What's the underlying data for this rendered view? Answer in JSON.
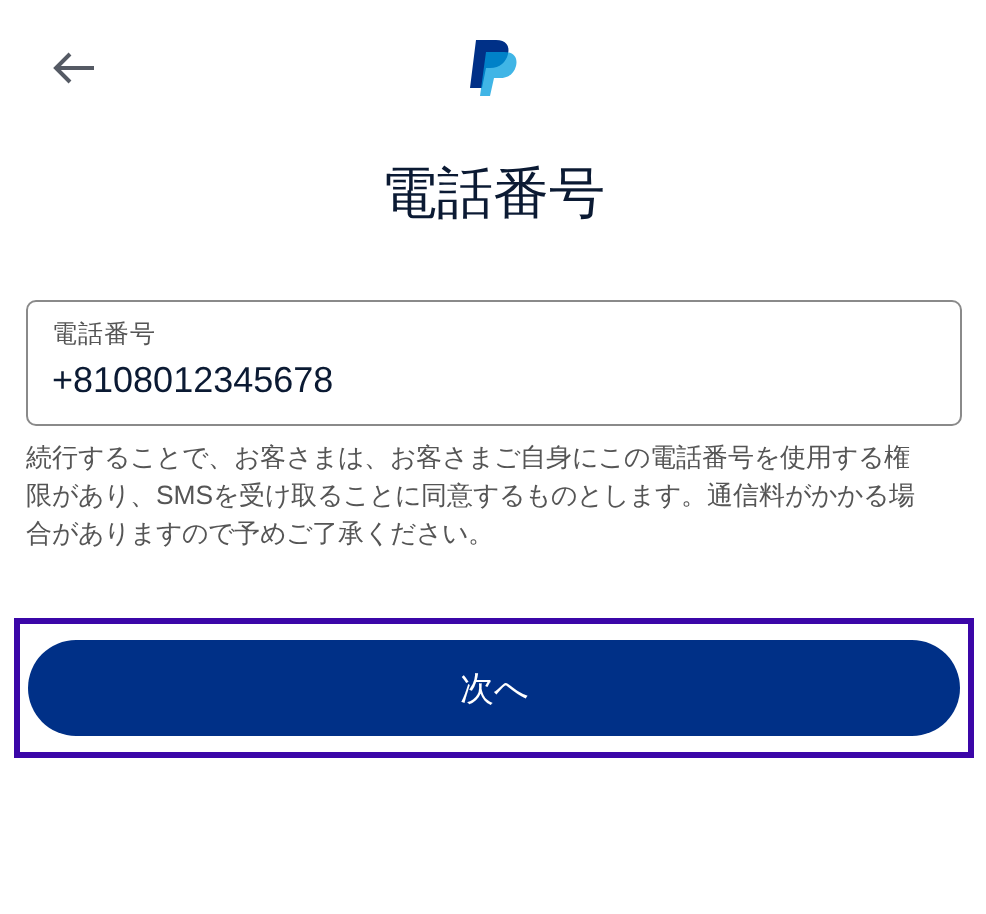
{
  "header": {
    "title": "電話番号"
  },
  "phone_field": {
    "label": "電話番号",
    "value": "+8108012345678"
  },
  "consent_text": "続行することで、お客さまは、お客さまご自身にこの電話番号を使用する権限があり、SMSを受け取ることに同意するものとします。通信料がかかる場合がありますので予めご了承ください。",
  "next_button": {
    "label": "次へ",
    "focused": true
  }
}
